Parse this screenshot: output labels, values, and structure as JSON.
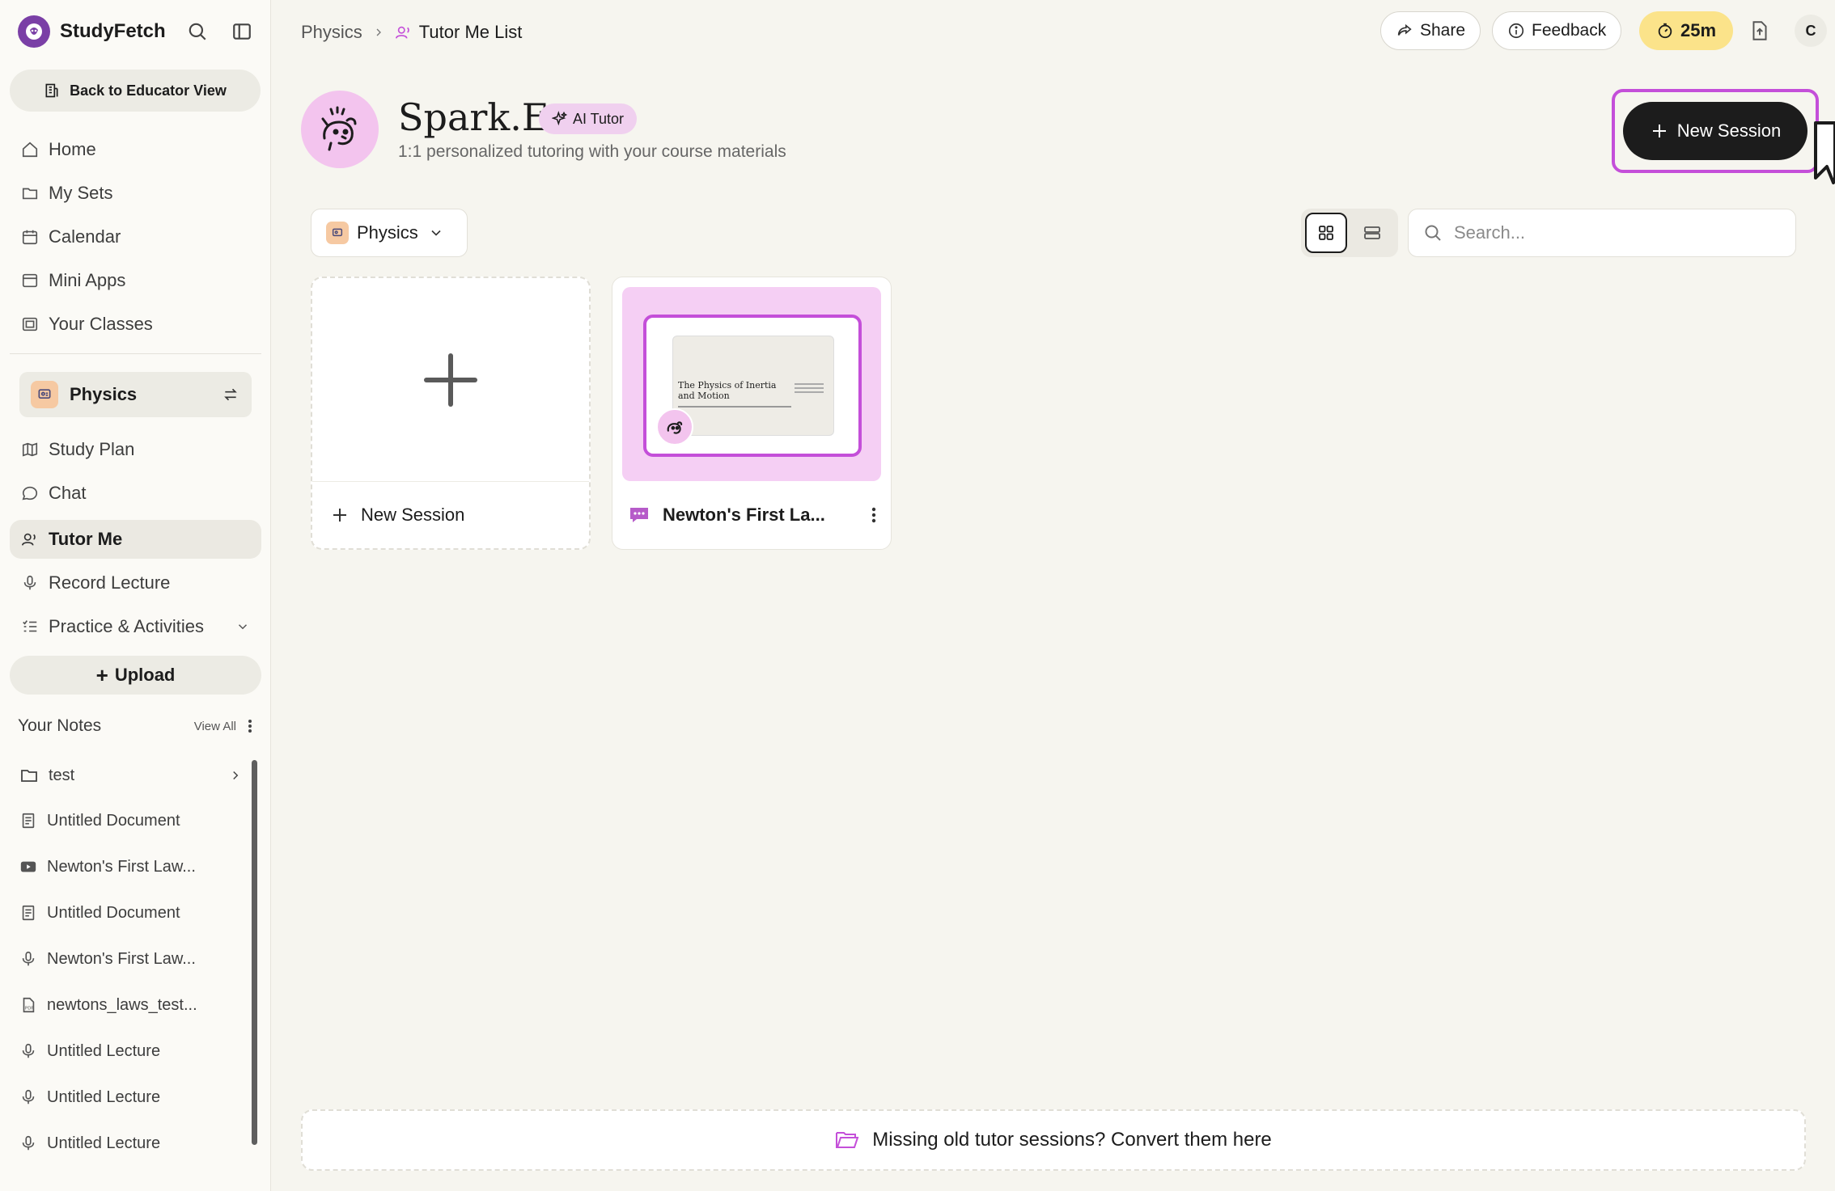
{
  "brand": {
    "name": "StudyFetch"
  },
  "sidebar": {
    "back_label": "Back to Educator View",
    "nav": [
      {
        "label": "Home",
        "icon": "home-icon"
      },
      {
        "label": "My Sets",
        "icon": "folder-icon"
      },
      {
        "label": "Calendar",
        "icon": "calendar-icon"
      },
      {
        "label": "Mini Apps",
        "icon": "window-icon"
      },
      {
        "label": "Your Classes",
        "icon": "classes-icon"
      }
    ],
    "current_class": "Physics",
    "class_nav": [
      {
        "label": "Study Plan",
        "icon": "map-icon"
      },
      {
        "label": "Chat",
        "icon": "chat-bubble-icon"
      },
      {
        "label": "Tutor Me",
        "icon": "tutor-icon",
        "active": true
      },
      {
        "label": "Record Lecture",
        "icon": "microphone-icon"
      },
      {
        "label": "Practice & Activities",
        "icon": "checklist-icon"
      }
    ],
    "upload_label": "Upload",
    "notes_title": "Your Notes",
    "notes_view_all": "View All",
    "notes": [
      {
        "label": "test",
        "icon": "folder-icon"
      },
      {
        "label": "Untitled Document",
        "icon": "document-icon"
      },
      {
        "label": "Newton's First Law...",
        "icon": "video-icon"
      },
      {
        "label": "Untitled Document",
        "icon": "document-icon"
      },
      {
        "label": "Newton's First Law...",
        "icon": "microphone-icon"
      },
      {
        "label": "newtons_laws_test...",
        "icon": "pdf-icon"
      },
      {
        "label": "Untitled Lecture",
        "icon": "microphone-icon"
      },
      {
        "label": "Untitled Lecture",
        "icon": "microphone-icon"
      },
      {
        "label": "Untitled Lecture",
        "icon": "microphone-icon"
      }
    ]
  },
  "header": {
    "breadcrumb": [
      "Physics",
      "Tutor Me List"
    ],
    "share_label": "Share",
    "feedback_label": "Feedback",
    "timer_label": "25m",
    "avatar_letter": "C"
  },
  "tutor": {
    "name": "Spark.E",
    "badge": "AI Tutor",
    "subtitle": "1:1 personalized tutoring with your course materials",
    "new_session_label": "New Session"
  },
  "toolbar": {
    "class_filter": "Physics",
    "search_placeholder": "Search..."
  },
  "cards": {
    "new_label": "New Session",
    "sessions": [
      {
        "title": "Newton's First La...",
        "slide_title_1": "The Physics of Inertia",
        "slide_title_2": "and Motion"
      }
    ]
  },
  "footer": {
    "convert_label": "Missing old tutor sessions? Convert them here"
  },
  "colors": {
    "accent": "#c44fd9",
    "tutor_bg": "#f3c4ee",
    "timer": "#fbe38a",
    "dark": "#1c1c1c"
  }
}
